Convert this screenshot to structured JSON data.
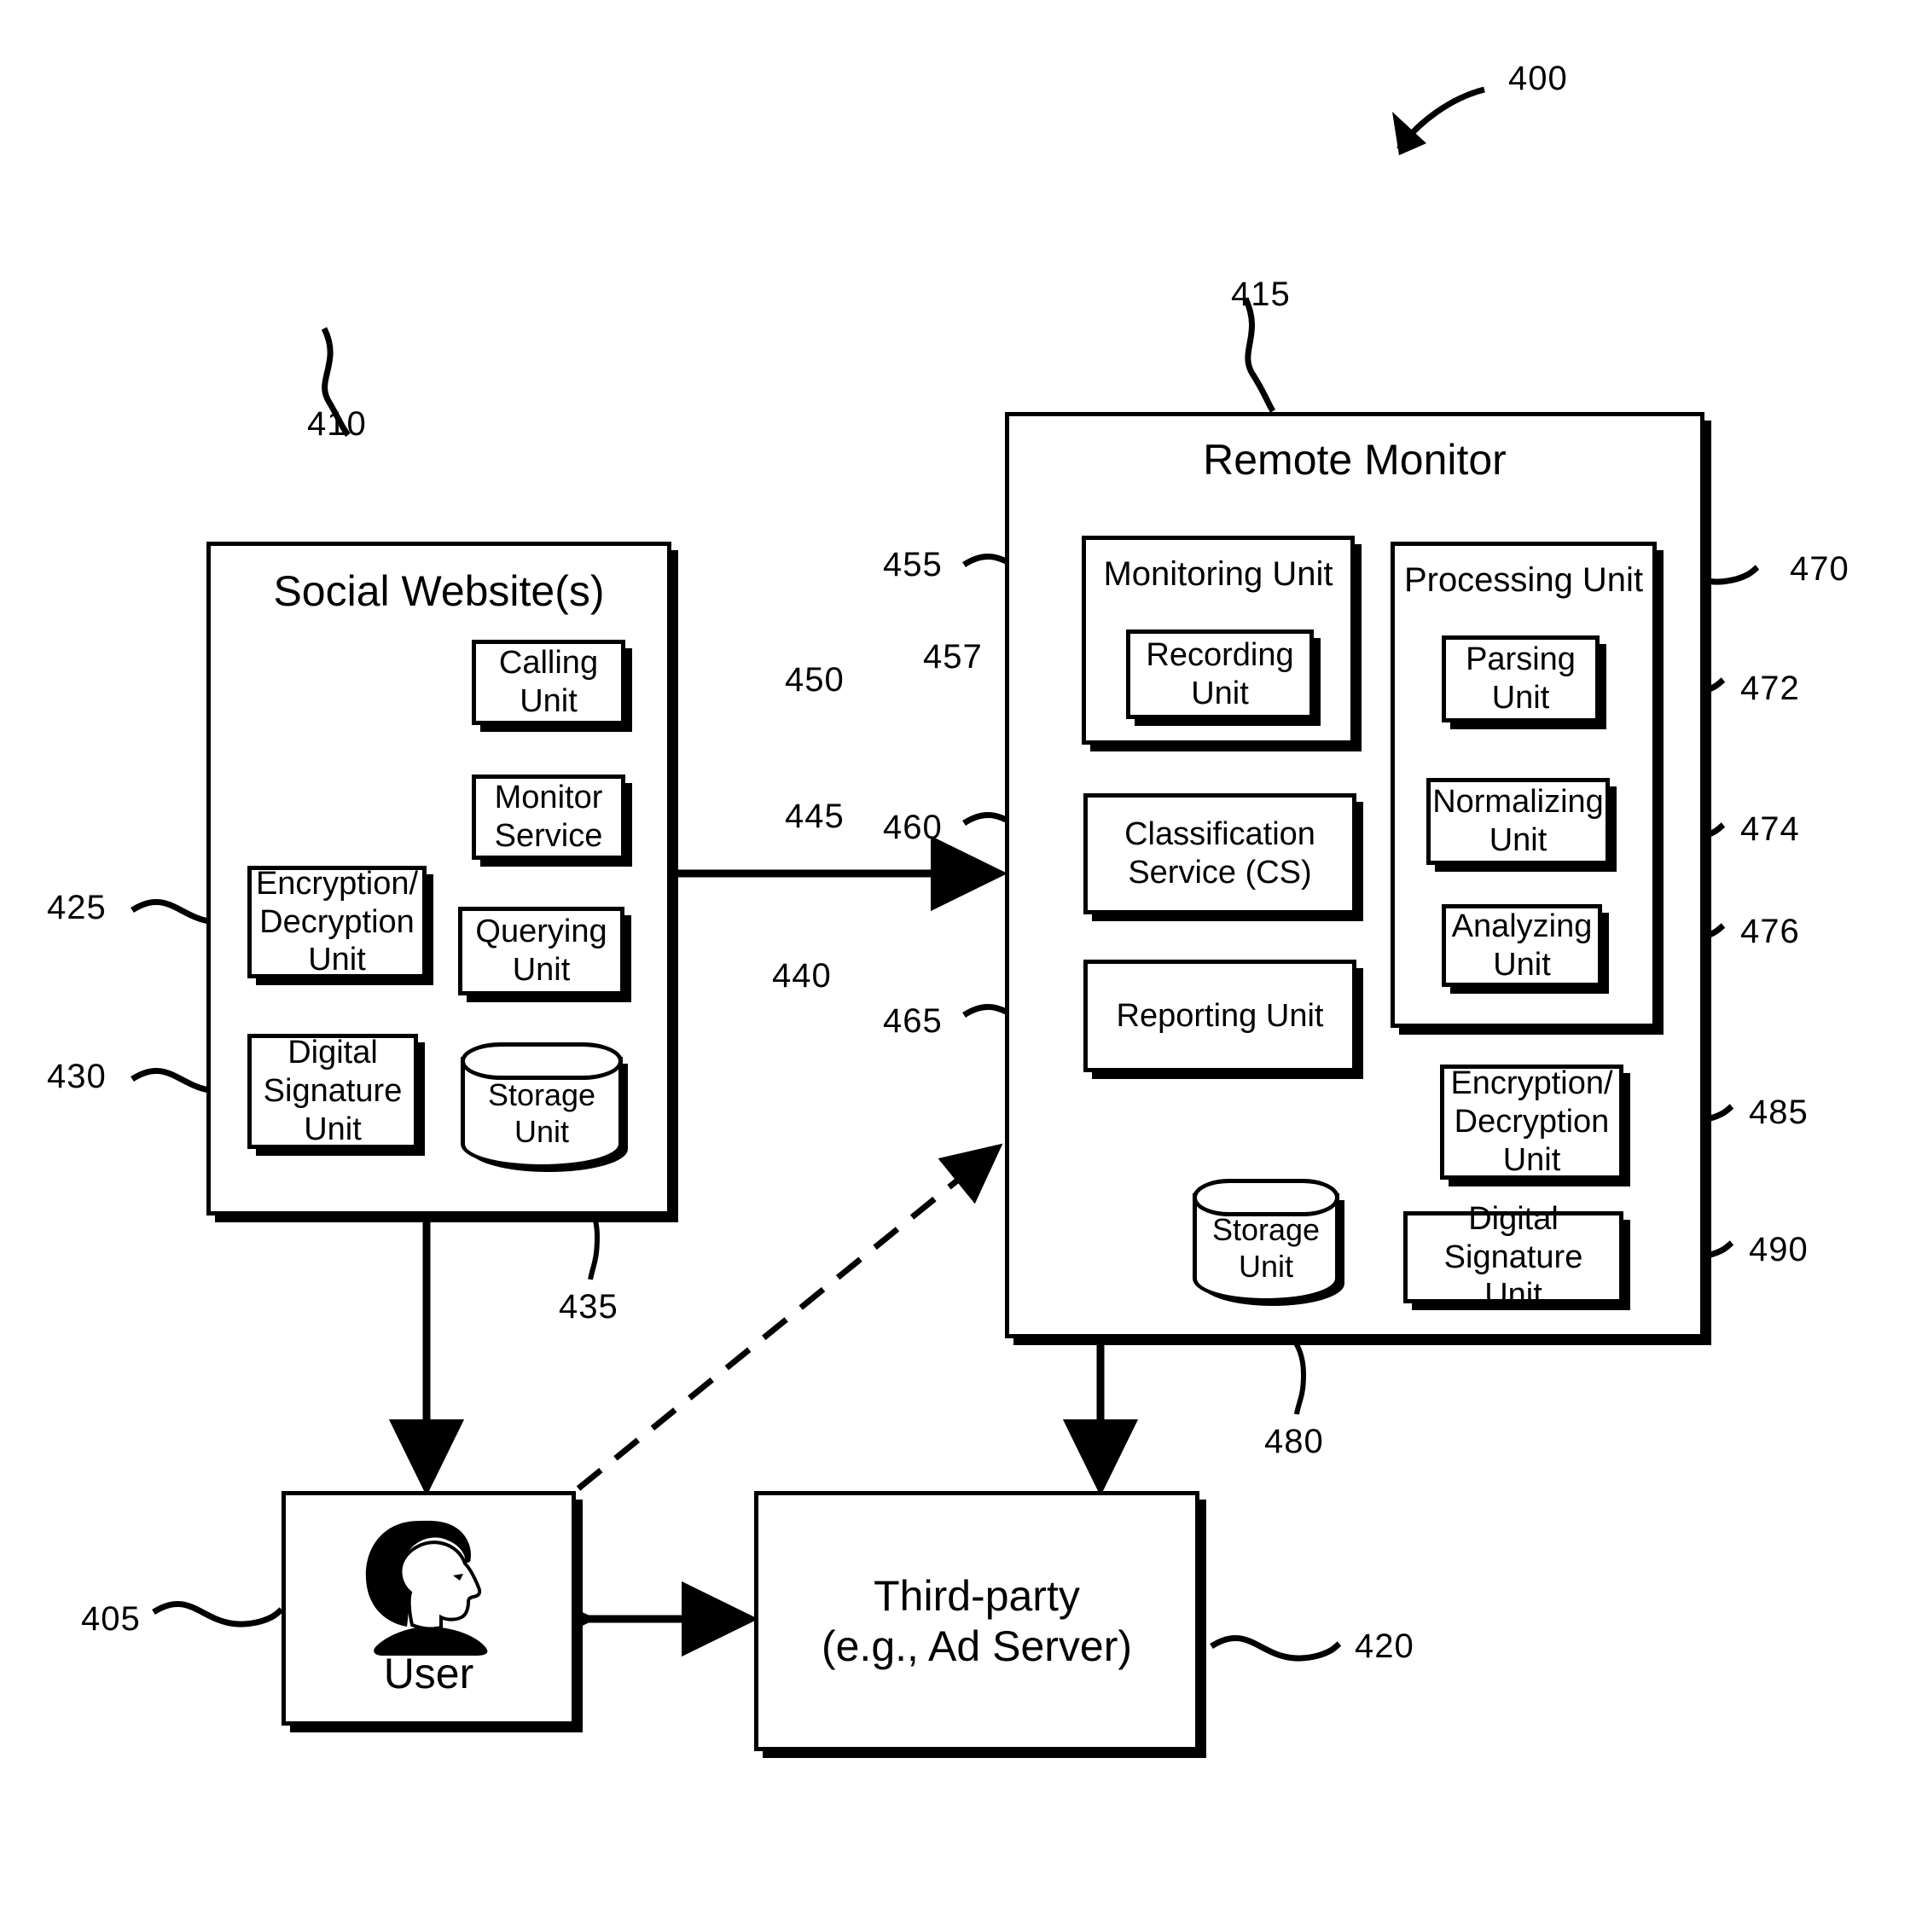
{
  "figure": {
    "number": "400",
    "title": ""
  },
  "social_website": {
    "ref": "410",
    "title": "Social Website(s)",
    "units": [
      {
        "ref": "450",
        "label": "Calling\nUnit"
      },
      {
        "ref": "445",
        "label": "Monitor\nService"
      },
      {
        "ref": "440",
        "label": "Querying\nUnit"
      },
      {
        "ref": "425",
        "label": "Encryption/\nDecryption\nUnit"
      },
      {
        "ref": "430",
        "label": "Digital\nSignature\nUnit"
      },
      {
        "ref": "435",
        "label": "Storage\nUnit"
      }
    ],
    "calling_unit": "Calling\nUnit",
    "monitor_service": "Monitor\nService",
    "querying_unit": "Querying\nUnit",
    "encryption_unit": "Encryption/\nDecryption\nUnit",
    "digital_signature_unit": "Digital\nSignature\nUnit",
    "storage_unit": "Storage\nUnit",
    "ref_calling": "450",
    "ref_monitor": "445",
    "ref_querying": "440",
    "ref_encryption": "425",
    "ref_signature": "430",
    "ref_storage": "435"
  },
  "remote_monitor": {
    "ref": "415",
    "title": "Remote Monitor",
    "monitoring_unit": {
      "ref": "455",
      "label": "Monitoring Unit"
    },
    "recording_unit": {
      "ref": "457",
      "label": "Recording\nUnit"
    },
    "classification_service": {
      "ref": "460",
      "label": "Classification\nService (CS)"
    },
    "reporting_unit": {
      "ref": "465",
      "label": "Reporting Unit"
    },
    "processing_unit": {
      "ref": "470",
      "label": "Processing Unit"
    },
    "parsing_unit": {
      "ref": "472",
      "label": "Parsing\nUnit"
    },
    "normalizing_unit": {
      "ref": "474",
      "label": "Normalizing\nUnit"
    },
    "analyzing_unit": {
      "ref": "476",
      "label": "Analyzing\nUnit"
    },
    "storage_unit": {
      "ref": "480",
      "label": "Storage\nUnit"
    },
    "encryption_unit": {
      "ref": "485",
      "label": "Encryption/\nDecryption\nUnit"
    },
    "digital_signature_unit": {
      "ref": "490",
      "label": "Digital Signature\nUnit"
    }
  },
  "user": {
    "ref": "405",
    "label": "User",
    "icon": "user-head-profile-icon"
  },
  "third_party": {
    "ref": "420",
    "label": "Third-party\n(e.g., Ad Server)"
  },
  "colors": {
    "ink": "#000000",
    "paper": "#ffffff"
  }
}
